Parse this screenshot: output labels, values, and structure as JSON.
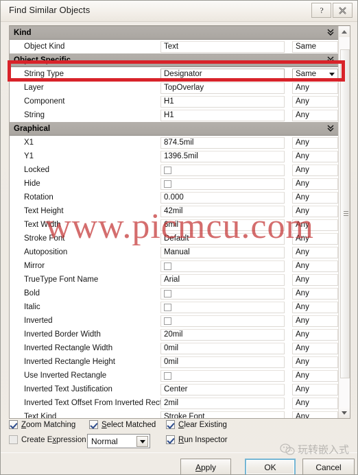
{
  "window": {
    "title": "Find Similar Objects",
    "help_button": "?",
    "close_button": "✕"
  },
  "grid": {
    "rows": [
      {
        "type": "group",
        "name": "Kind"
      },
      {
        "type": "data",
        "name": "Object Kind",
        "value": "Text",
        "value_kind": "text",
        "match": "Same",
        "match_dropdown": false
      },
      {
        "type": "group",
        "name": "Object Specific"
      },
      {
        "type": "data",
        "name": "String Type",
        "value": "Designator",
        "value_kind": "text",
        "match": "Same",
        "match_dropdown": true,
        "selected": true
      },
      {
        "type": "data",
        "name": "Layer",
        "value": "TopOverlay",
        "value_kind": "text",
        "match": "Any",
        "match_dropdown": false
      },
      {
        "type": "data",
        "name": "Component",
        "value": "H1",
        "value_kind": "text",
        "match": "Any",
        "match_dropdown": false
      },
      {
        "type": "data",
        "name": "String",
        "value": "H1",
        "value_kind": "text",
        "match": "Any",
        "match_dropdown": false
      },
      {
        "type": "group",
        "name": "Graphical"
      },
      {
        "type": "data",
        "name": "X1",
        "value": "874.5mil",
        "value_kind": "text",
        "match": "Any",
        "match_dropdown": false
      },
      {
        "type": "data",
        "name": "Y1",
        "value": "1396.5mil",
        "value_kind": "text",
        "match": "Any",
        "match_dropdown": false
      },
      {
        "type": "data",
        "name": "Locked",
        "value": "",
        "value_kind": "checkbox",
        "checked": false,
        "match": "Any",
        "match_dropdown": false
      },
      {
        "type": "data",
        "name": "Hide",
        "value": "",
        "value_kind": "checkbox",
        "checked": false,
        "match": "Any",
        "match_dropdown": false
      },
      {
        "type": "data",
        "name": "Rotation",
        "value": "0.000",
        "value_kind": "text",
        "match": "Any",
        "match_dropdown": false
      },
      {
        "type": "data",
        "name": "Text Height",
        "value": "42mil",
        "value_kind": "text",
        "match": "Any",
        "match_dropdown": false
      },
      {
        "type": "data",
        "name": "Text Width",
        "value": "6mil",
        "value_kind": "text",
        "match": "Any",
        "match_dropdown": false
      },
      {
        "type": "data",
        "name": "Stroke Font",
        "value": "Default",
        "value_kind": "text",
        "match": "Any",
        "match_dropdown": false
      },
      {
        "type": "data",
        "name": "Autoposition",
        "value": "Manual",
        "value_kind": "text",
        "match": "Any",
        "match_dropdown": false
      },
      {
        "type": "data",
        "name": "Mirror",
        "value": "",
        "value_kind": "checkbox",
        "checked": false,
        "match": "Any",
        "match_dropdown": false
      },
      {
        "type": "data",
        "name": "TrueType Font Name",
        "value": "Arial",
        "value_kind": "text",
        "match": "Any",
        "match_dropdown": false
      },
      {
        "type": "data",
        "name": "Bold",
        "value": "",
        "value_kind": "checkbox",
        "checked": false,
        "match": "Any",
        "match_dropdown": false
      },
      {
        "type": "data",
        "name": "Italic",
        "value": "",
        "value_kind": "checkbox",
        "checked": false,
        "match": "Any",
        "match_dropdown": false
      },
      {
        "type": "data",
        "name": "Inverted",
        "value": "",
        "value_kind": "checkbox",
        "checked": false,
        "match": "Any",
        "match_dropdown": false
      },
      {
        "type": "data",
        "name": "Inverted Border Width",
        "value": "20mil",
        "value_kind": "text",
        "match": "Any",
        "match_dropdown": false
      },
      {
        "type": "data",
        "name": "Inverted Rectangle Width",
        "value": "0mil",
        "value_kind": "text",
        "match": "Any",
        "match_dropdown": false
      },
      {
        "type": "data",
        "name": "Inverted Rectangle Height",
        "value": "0mil",
        "value_kind": "text",
        "match": "Any",
        "match_dropdown": false
      },
      {
        "type": "data",
        "name": "Use Inverted Rectangle",
        "value": "",
        "value_kind": "checkbox",
        "checked": false,
        "match": "Any",
        "match_dropdown": false
      },
      {
        "type": "data",
        "name": "Inverted Text Justification",
        "value": "Center",
        "value_kind": "text",
        "match": "Any",
        "match_dropdown": false
      },
      {
        "type": "data",
        "name": "Inverted Text Offset From Inverted Rect",
        "value": "2mil",
        "value_kind": "text",
        "match": "Any",
        "match_dropdown": false
      },
      {
        "type": "data",
        "name": "Text Kind",
        "value": "Stroke Font",
        "value_kind": "text",
        "match": "Any",
        "match_dropdown": false
      }
    ]
  },
  "options": {
    "zoom_matching": {
      "label": "Zoom Matching",
      "accel": "Z",
      "checked": true
    },
    "select_matched": {
      "label": "Select Matched",
      "accel": "S",
      "checked": true
    },
    "clear_existing": {
      "label": "Clear Existing",
      "accel": "C",
      "checked": true
    },
    "create_expression": {
      "label": "Create Expression",
      "accel": "x",
      "checked": false
    },
    "run_inspector": {
      "label": "Run Inspector",
      "accel": "R",
      "checked": true
    },
    "scope_combo": {
      "value": "Normal"
    }
  },
  "buttons": {
    "apply": {
      "label": "Apply",
      "accel": "A"
    },
    "ok": {
      "label": "OK"
    },
    "cancel": {
      "label": "Cancel"
    }
  },
  "watermark": {
    "text": "www.picmcu.com",
    "wechat_text": "玩转嵌入式"
  },
  "colors": {
    "annotation_red": "#d8232a",
    "group_header": "#aaa6a1",
    "focus_blue": "#74b6d4"
  }
}
